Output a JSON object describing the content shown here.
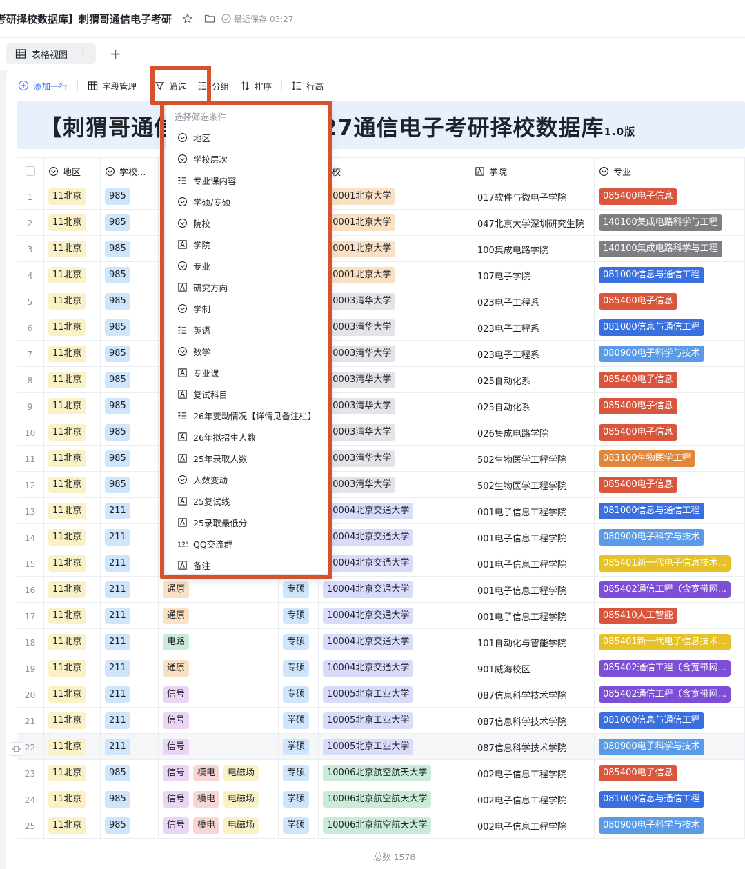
{
  "topbar": {
    "title": "考研择校数据库】刺猬哥通信电子考研",
    "saved": "最近保存 03:27",
    "icons": [
      "star-icon",
      "folder-icon",
      "check-circle-icon"
    ]
  },
  "viewbar": {
    "tab_label": "表格视图",
    "more": "⋮",
    "add": "+"
  },
  "toolbar": {
    "add_row": "添加一行",
    "fields": "字段管理",
    "filter": "筛选",
    "group": "分组",
    "sort": "排序",
    "row_height": "行高"
  },
  "banner": {
    "left": "【刺猬哥通信",
    "right": "27通信电子考研择校数据库",
    "version": "1.0版"
  },
  "columns": [
    {
      "label": "",
      "icon": "checkbox"
    },
    {
      "label": "地区",
      "icon": "select"
    },
    {
      "label": "学校...",
      "icon": "select"
    },
    {
      "label": "",
      "icon": ""
    },
    {
      "label": "",
      "icon": ""
    },
    {
      "label": "院校",
      "icon": ""
    },
    {
      "label": "学院",
      "icon": "text"
    },
    {
      "label": "专业",
      "icon": "select"
    }
  ],
  "filter_popup": {
    "title": "选择筛选条件",
    "items": [
      {
        "label": "地区",
        "icon": "select"
      },
      {
        "label": "学校层次",
        "icon": "select"
      },
      {
        "label": "专业课内容",
        "icon": "multi"
      },
      {
        "label": "学硕/专硕",
        "icon": "select"
      },
      {
        "label": "院校",
        "icon": "select"
      },
      {
        "label": "学院",
        "icon": "text"
      },
      {
        "label": "专业",
        "icon": "select"
      },
      {
        "label": "研究方向",
        "icon": "text"
      },
      {
        "label": "学制",
        "icon": "select"
      },
      {
        "label": "英语",
        "icon": "multi"
      },
      {
        "label": "数学",
        "icon": "select"
      },
      {
        "label": "专业课",
        "icon": "text"
      },
      {
        "label": "复试科目",
        "icon": "text"
      },
      {
        "label": "26年变动情况【详情见备注栏】",
        "icon": "multi"
      },
      {
        "label": "26年拟招生人数",
        "icon": "text"
      },
      {
        "label": "25年录取人数",
        "icon": "text"
      },
      {
        "label": "人数变动",
        "icon": "select"
      },
      {
        "label": "25复试线",
        "icon": "text"
      },
      {
        "label": "25录取最低分",
        "icon": "text"
      },
      {
        "label": "QQ交流群",
        "icon": "number"
      },
      {
        "label": "备注",
        "icon": "text"
      }
    ]
  },
  "colors": {
    "highlight": "#d4532c",
    "accent": "#3370ff",
    "region": "#fbf1c7",
    "tier985": "#cfe5fb",
    "tier211": "#cfe5fb",
    "school": "#fbe1c4",
    "schoolAlt": "#d9dbfa",
    "schoolGreen": "#cbebd9",
    "schoolGray": "#e3e4e7",
    "deg": "#cfe5fb",
    "maj_red": "#d9553b",
    "maj_gray": "#7d7f83",
    "maj_blue": "#3a6fe0",
    "maj_lblue": "#5b9ae6",
    "maj_orange": "#e2873a",
    "maj_yellow": "#e6c228",
    "maj_purple": "#7d4fd6"
  },
  "rows": [
    {
      "n": "1",
      "region": "11北京",
      "tier": "985",
      "subjects": [],
      "degree": "",
      "school": "10001北京大学",
      "school_c": "school",
      "college": "017软件与微电子学院",
      "major": "085400电子信息",
      "major_c": "maj_red"
    },
    {
      "n": "2",
      "region": "11北京",
      "tier": "985",
      "subjects": [],
      "degree": "",
      "school": "10001北京大学",
      "school_c": "school",
      "college": "047北京大学深圳研究生院",
      "major": "140100集成电路科学与工程",
      "major_c": "maj_gray"
    },
    {
      "n": "3",
      "region": "11北京",
      "tier": "985",
      "subjects": [],
      "degree": "",
      "school": "10001北京大学",
      "school_c": "school",
      "college": "100集成电路学院",
      "major": "140100集成电路科学与工程",
      "major_c": "maj_gray"
    },
    {
      "n": "4",
      "region": "11北京",
      "tier": "985",
      "subjects": [],
      "degree": "",
      "school": "10001北京大学",
      "school_c": "school",
      "college": "107电子学院",
      "major": "081000信息与通信工程",
      "major_c": "maj_blue"
    },
    {
      "n": "5",
      "region": "11北京",
      "tier": "985",
      "subjects": [],
      "degree": "",
      "school": "10003清华大学",
      "school_c": "schoolGray",
      "college": "023电子工程系",
      "major": "085400电子信息",
      "major_c": "maj_red"
    },
    {
      "n": "6",
      "region": "11北京",
      "tier": "985",
      "subjects": [],
      "degree": "",
      "school": "10003清华大学",
      "school_c": "schoolGray",
      "college": "023电子工程系",
      "major": "081000信息与通信工程",
      "major_c": "maj_blue"
    },
    {
      "n": "7",
      "region": "11北京",
      "tier": "985",
      "subjects": [],
      "degree": "",
      "school": "10003清华大学",
      "school_c": "schoolGray",
      "college": "023电子工程系",
      "major": "080900电子科学与技术",
      "major_c": "maj_lblue"
    },
    {
      "n": "8",
      "region": "11北京",
      "tier": "985",
      "subjects": [],
      "degree": "",
      "school": "10003清华大学",
      "school_c": "schoolGray",
      "college": "025自动化系",
      "major": "085400电子信息",
      "major_c": "maj_red"
    },
    {
      "n": "9",
      "region": "11北京",
      "tier": "985",
      "subjects": [],
      "degree": "",
      "school": "10003清华大学",
      "school_c": "schoolGray",
      "college": "025自动化系",
      "major": "085400电子信息",
      "major_c": "maj_red"
    },
    {
      "n": "10",
      "region": "11北京",
      "tier": "985",
      "subjects": [],
      "degree": "",
      "school": "10003清华大学",
      "school_c": "schoolGray",
      "college": "026集成电路学院",
      "major": "085400电子信息",
      "major_c": "maj_red"
    },
    {
      "n": "11",
      "region": "11北京",
      "tier": "985",
      "subjects": [],
      "degree": "",
      "school": "10003清华大学",
      "school_c": "schoolGray",
      "college": "502生物医学工程学院",
      "major": "083100生物医学工程",
      "major_c": "maj_orange"
    },
    {
      "n": "12",
      "region": "11北京",
      "tier": "985",
      "subjects": [],
      "degree": "",
      "school": "10003清华大学",
      "school_c": "schoolGray",
      "college": "502生物医学工程学院",
      "major": "085400电子信息",
      "major_c": "maj_red"
    },
    {
      "n": "13",
      "region": "11北京",
      "tier": "211",
      "subjects": [],
      "degree": "",
      "school": "10004北京交通大学",
      "school_c": "schoolAlt",
      "college": "001电子信息工程学院",
      "major": "081000信息与通信工程",
      "major_c": "maj_blue"
    },
    {
      "n": "14",
      "region": "11北京",
      "tier": "211",
      "subjects": [],
      "degree": "",
      "school": "10004北京交通大学",
      "school_c": "schoolAlt",
      "college": "001电子信息工程学院",
      "major": "080900电子科学与技术",
      "major_c": "maj_lblue"
    },
    {
      "n": "15",
      "region": "11北京",
      "tier": "211",
      "subjects": [],
      "degree": "",
      "school": "10004北京交通大学",
      "school_c": "schoolAlt",
      "college": "001电子信息工程学院",
      "major": "085401新一代电子信息技术...",
      "major_c": "maj_yellow"
    },
    {
      "n": "16",
      "region": "11北京",
      "tier": "211",
      "subjects": [
        {
          "t": "通原",
          "c": "#fbe1c4"
        }
      ],
      "degree": "专硕",
      "school": "10004北京交通大学",
      "school_c": "schoolAlt",
      "college": "001电子信息工程学院",
      "major": "085402通信工程（含宽带网...",
      "major_c": "maj_purple"
    },
    {
      "n": "17",
      "region": "11北京",
      "tier": "211",
      "subjects": [
        {
          "t": "通原",
          "c": "#fbe1c4"
        }
      ],
      "degree": "专硕",
      "school": "10004北京交通大学",
      "school_c": "schoolAlt",
      "college": "001电子信息工程学院",
      "major": "085410人工智能",
      "major_c": "maj_red"
    },
    {
      "n": "18",
      "region": "11北京",
      "tier": "211",
      "subjects": [
        {
          "t": "电路",
          "c": "#cbebd9"
        }
      ],
      "degree": "专硕",
      "school": "10004北京交通大学",
      "school_c": "schoolAlt",
      "college": "101自动化与智能学院",
      "major": "085401新一代电子信息技术...",
      "major_c": "maj_yellow"
    },
    {
      "n": "19",
      "region": "11北京",
      "tier": "211",
      "subjects": [
        {
          "t": "通原",
          "c": "#fbe1c4"
        }
      ],
      "degree": "专硕",
      "school": "10004北京交通大学",
      "school_c": "schoolAlt",
      "college": "901威海校区",
      "major": "085402通信工程（含宽带网...",
      "major_c": "maj_purple"
    },
    {
      "n": "20",
      "region": "11北京",
      "tier": "211",
      "subjects": [
        {
          "t": "信号",
          "c": "#ecd4f5"
        }
      ],
      "degree": "专硕",
      "school": "10005北京工业大学",
      "school_c": "schoolAlt",
      "college": "087信息科学技术学院",
      "major": "085402通信工程（含宽带网...",
      "major_c": "maj_purple"
    },
    {
      "n": "21",
      "region": "11北京",
      "tier": "211",
      "subjects": [
        {
          "t": "信号",
          "c": "#ecd4f5"
        }
      ],
      "degree": "学硕",
      "school": "10005北京工业大学",
      "school_c": "schoolAlt",
      "college": "087信息科学技术学院",
      "major": "081000信息与通信工程",
      "major_c": "maj_blue"
    },
    {
      "n": "22",
      "region": "11北京",
      "tier": "211",
      "subjects": [
        {
          "t": "信号",
          "c": "#ecd4f5"
        }
      ],
      "degree": "学硕",
      "school": "10005北京工业大学",
      "school_c": "schoolAlt",
      "college": "087信息科学技术学院",
      "major": "080900电子科学与技术",
      "major_c": "maj_lblue"
    },
    {
      "n": "23",
      "region": "11北京",
      "tier": "985",
      "subjects": [
        {
          "t": "信号",
          "c": "#ecd4f5"
        },
        {
          "t": "模电",
          "c": "#f8d6d3"
        },
        {
          "t": "电磁场",
          "c": "#fbf1c7"
        }
      ],
      "degree": "专硕",
      "school": "10006北京航空航天大学",
      "school_c": "schoolGreen",
      "college": "002电子信息工程学院",
      "major": "085400电子信息",
      "major_c": "maj_red"
    },
    {
      "n": "24",
      "region": "11北京",
      "tier": "985",
      "subjects": [
        {
          "t": "信号",
          "c": "#ecd4f5"
        },
        {
          "t": "模电",
          "c": "#f8d6d3"
        },
        {
          "t": "电磁场",
          "c": "#fbf1c7"
        }
      ],
      "degree": "学硕",
      "school": "10006北京航空航天大学",
      "school_c": "schoolGreen",
      "college": "002电子信息工程学院",
      "major": "081000信息与通信工程",
      "major_c": "maj_blue"
    },
    {
      "n": "25",
      "region": "11北京",
      "tier": "985",
      "subjects": [
        {
          "t": "信号",
          "c": "#ecd4f5"
        },
        {
          "t": "模电",
          "c": "#f8d6d3"
        },
        {
          "t": "电磁场",
          "c": "#fbf1c7"
        }
      ],
      "degree": "学硕",
      "school": "10006北京航空航天大学",
      "school_c": "schoolGreen",
      "college": "002电子信息工程学院",
      "major": "080900电子科学与技术",
      "major_c": "maj_lblue"
    }
  ],
  "footer": {
    "total": "总数 1578"
  }
}
